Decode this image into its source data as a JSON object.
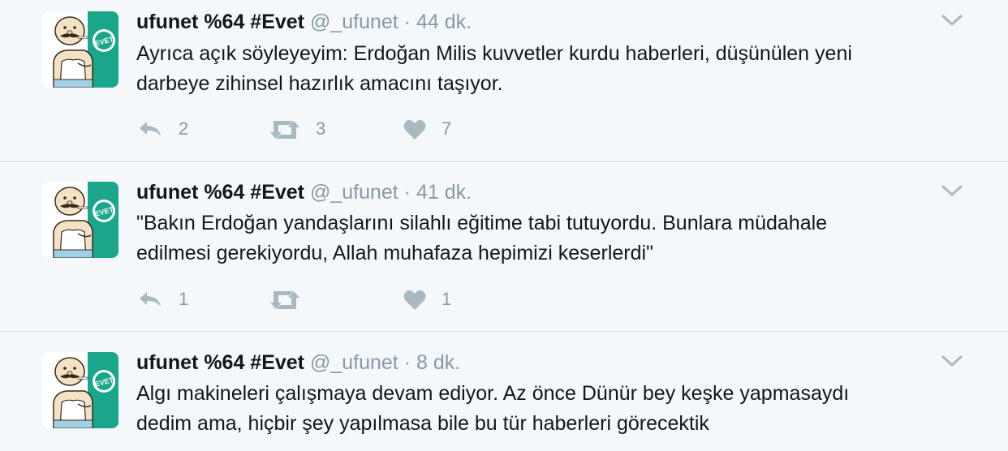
{
  "tweets": [
    {
      "name": "ufunet %64 #Evet",
      "handle": "@_ufunet",
      "dot": "·",
      "time": "44 dk.",
      "text_line1": "Ayrıca açık söyleyeyim: Erdoğan Milis kuvvetler kurdu haberleri, düşünülen yeni",
      "text_line2": "darbeye zihinsel hazırlık amacını taşıyor.",
      "replies": "2",
      "retweets": "3",
      "likes": "7"
    },
    {
      "name": "ufunet %64 #Evet",
      "handle": "@_ufunet",
      "dot": "·",
      "time": "41 dk.",
      "text_line1": "\"Bakın Erdoğan yandaşlarını silahlı eğitime tabi tutuyordu. Bunlara müdahale",
      "text_line2": "edilmesi gerekiyordu, Allah muhafaza hepimizi keserlerdi\"",
      "replies": "1",
      "retweets": "",
      "likes": "1"
    },
    {
      "name": "ufunet %64 #Evet",
      "handle": "@_ufunet",
      "dot": "·",
      "time": "8 dk.",
      "text_line1": "Algı makineleri çalışmaya devam ediyor. Az önce Dünür bey keşke yapmasaydı",
      "text_line2": "dedim ama, hiçbir şey yapılmasa bile bu tür haberleri görecektik"
    }
  ],
  "avatar_badge": "EVET",
  "colors": {
    "background": "#f5f8fa",
    "divider": "#e1e8ed",
    "muted": "#8899a6",
    "icon": "#aab8c2",
    "badge": "#1aa68a"
  },
  "icons": [
    "reply-icon",
    "retweet-icon",
    "like-icon",
    "caret-down-icon"
  ]
}
